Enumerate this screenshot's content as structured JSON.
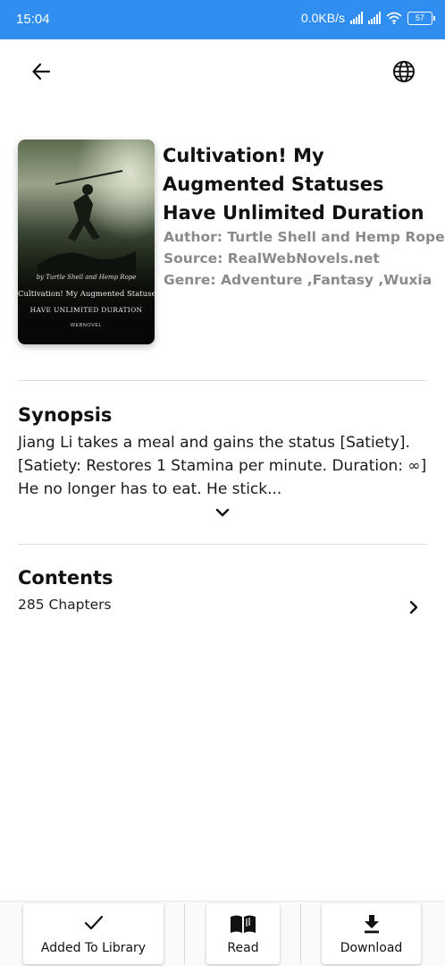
{
  "status_bar": {
    "time": "15:04",
    "net_speed": "0.0KB/s",
    "battery": "57",
    "icons": [
      "signal-icon",
      "signal-icon",
      "wifi-icon",
      "battery-icon"
    ]
  },
  "toolbar": {
    "back_icon": "arrow-left-icon",
    "language_icon": "globe-icon"
  },
  "book": {
    "title": "Cultivation! My Augmented Statuses Have Unlimited Duration",
    "author": "Author: Turtle Shell and Hemp Rope",
    "source": "Source: RealWebNovels.net",
    "genre": "Genre: Adventure ,Fantasy ,Wuxia",
    "cover": {
      "byline": "by Turtle Shell and Hemp Rope",
      "title_line1": "Cultivation! My Augmented Statuses",
      "title_line2": "HAVE UNLIMITED DURATION",
      "logo": "WEBNOVEL"
    }
  },
  "synopsis": {
    "heading": "Synopsis",
    "text": "Jiang Li takes a meal and gains the status [Satiety]. [Satiety: Restores 1 Stamina per minute. Duration: ∞] He no longer has to eat. He stick...",
    "expand_icon": "chevron-down-icon"
  },
  "contents": {
    "heading": "Contents",
    "count": "285 Chapters",
    "open_icon": "chevron-right-icon"
  },
  "bottom_actions": [
    {
      "label": "Added To Library",
      "icon": "check-icon"
    },
    {
      "label": "Read",
      "icon": "book-open-icon"
    },
    {
      "label": "Download",
      "icon": "download-icon"
    }
  ],
  "colors": {
    "status_bar": "#2f8ef0",
    "meta_text": "#8a8a8a"
  }
}
